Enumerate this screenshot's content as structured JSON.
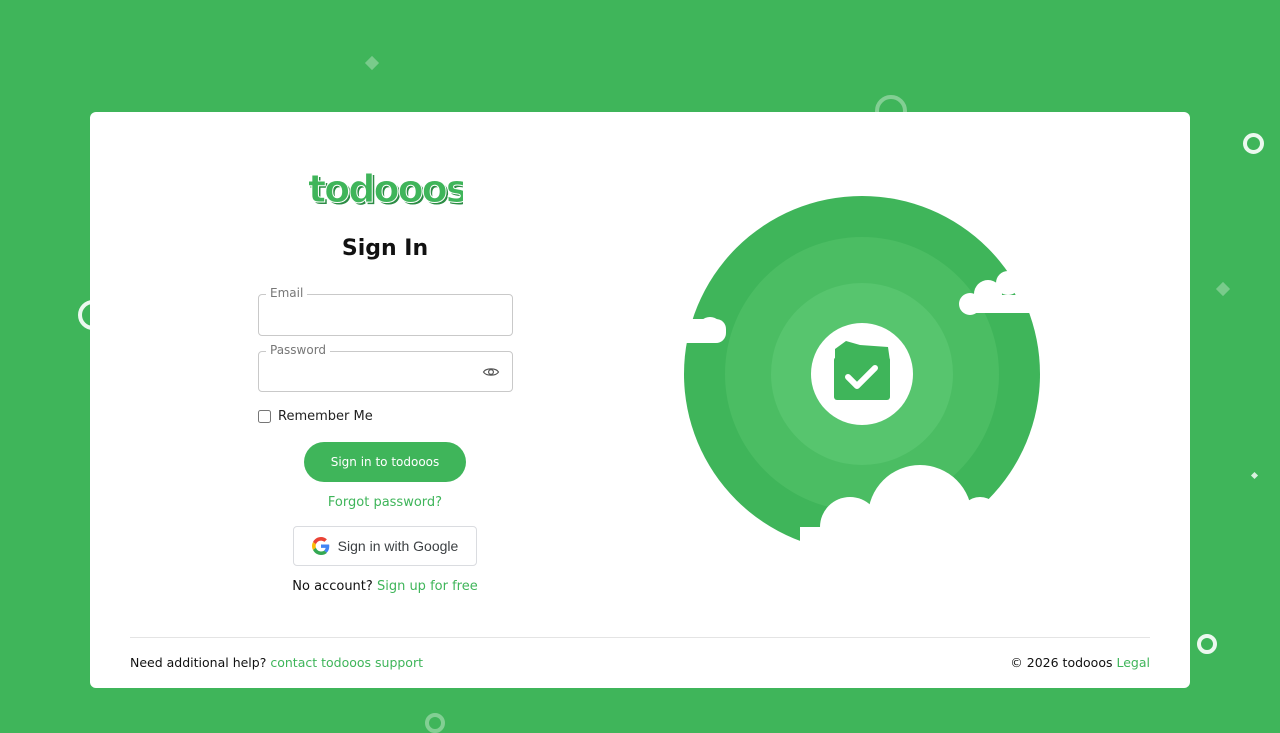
{
  "brand": {
    "logo_text": "todooos",
    "accent_color": "#3fb55a"
  },
  "signin": {
    "title": "Sign In",
    "email_label": "Email",
    "email_value": "",
    "password_label": "Password",
    "password_value": "",
    "show_password_icon": "eye-icon",
    "remember_label": "Remember Me",
    "remember_checked": false,
    "submit_label": "Sign in to todooos",
    "forgot_label": "Forgot password?",
    "google_label": "Sign in with Google",
    "no_account_text": "No account?",
    "signup_link": "Sign up for free"
  },
  "illustration": {
    "icon": "folder-check-icon"
  },
  "footer": {
    "help_text": "Need additional help?",
    "help_link": "contact todooos support",
    "copyright": "© 2026 todooos",
    "legal_link": "Legal"
  }
}
